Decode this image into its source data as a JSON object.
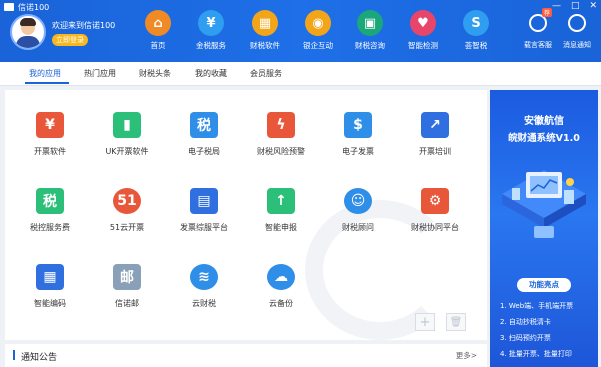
{
  "window": {
    "title": "信诺100",
    "controls": [
      "—",
      "□",
      "✕"
    ]
  },
  "user": {
    "welcome": "欢迎来到信诺100",
    "login_label": "立即登录"
  },
  "nav": [
    {
      "label": "首页",
      "glyph": "⌂",
      "color": "#f08a24"
    },
    {
      "label": "金税服务",
      "glyph": "¥",
      "color": "#2f9df0"
    },
    {
      "label": "财税软件",
      "glyph": "▦",
      "color": "#f3a51a"
    },
    {
      "label": "银企互动",
      "glyph": "◉",
      "color": "#f3a51a"
    },
    {
      "label": "财税咨询",
      "glyph": "▣",
      "color": "#1aa87a"
    },
    {
      "label": "智能检测",
      "glyph": "♥",
      "color": "#e8456a"
    },
    {
      "label": "荟智税",
      "glyph": "S",
      "color": "#2f9df0"
    }
  ],
  "right_icons": [
    {
      "label": "载言客服",
      "badge": "荐"
    },
    {
      "label": "消息通知"
    }
  ],
  "tabs": [
    "我的应用",
    "热门应用",
    "财税头条",
    "我的收藏",
    "会员服务"
  ],
  "apps": [
    {
      "label": "开票软件",
      "glyph": "¥",
      "color": "#e8573a"
    },
    {
      "label": "UK开票软件",
      "glyph": "▮",
      "color": "#2bbf7a"
    },
    {
      "label": "电子税局",
      "glyph": "税",
      "color": "#2f8ee8"
    },
    {
      "label": "财税风险预警",
      "glyph": "ϟ",
      "color": "#e8573a"
    },
    {
      "label": "电子发票",
      "glyph": "$",
      "color": "#2f8ee8"
    },
    {
      "label": "开票培训",
      "glyph": "↗",
      "color": "#2f6fe0"
    },
    {
      "label": "税控服务费",
      "glyph": "税",
      "color": "#2bbf7a"
    },
    {
      "label": "51云开票",
      "glyph": "51",
      "color": "#e8573a"
    },
    {
      "label": "发票综服平台",
      "glyph": "▤",
      "color": "#2f6fe0"
    },
    {
      "label": "智能申报",
      "glyph": "↑",
      "color": "#2bbf7a"
    },
    {
      "label": "财税顾问",
      "glyph": "☺",
      "color": "#2f8ee8"
    },
    {
      "label": "财税协同平台",
      "glyph": "⚙",
      "color": "#e8573a"
    },
    {
      "label": "智能编码",
      "glyph": "▦",
      "color": "#2f6fe0"
    },
    {
      "label": "信诺邮",
      "glyph": "邮",
      "color": "#8aa0b8"
    },
    {
      "label": "云财税",
      "glyph": "≋",
      "color": "#2f8ee8"
    },
    {
      "label": "云备份",
      "glyph": "☁",
      "color": "#2f8ee8"
    }
  ],
  "tools": {
    "add": "+",
    "delete": "🗑"
  },
  "notice": {
    "title": "通知公告",
    "more": "更多>"
  },
  "banner": {
    "title1": "安徽航信",
    "title2": "皖财通系统V1.0",
    "features_title": "功能亮点",
    "features": [
      "1. Web端、手机端开票",
      "2. 自动抄税清卡",
      "3. 扫码预约开票",
      "4. 批量开票、批量打印"
    ]
  }
}
